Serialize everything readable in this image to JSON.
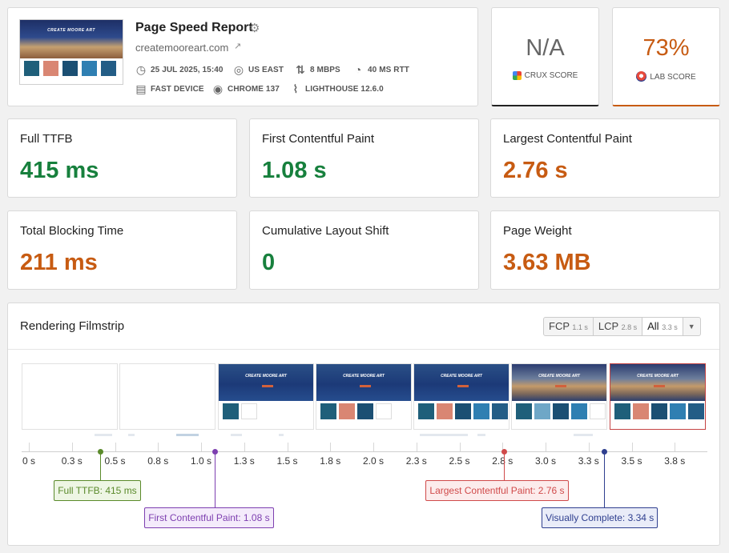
{
  "header": {
    "title": "Page Speed Report",
    "url": "createmooreart.com",
    "thumb_title": "CREATE MOORE ART",
    "meta": [
      {
        "icon": "clock-icon",
        "label": "25 JUL 2025, 15:40"
      },
      {
        "icon": "globe-icon",
        "label": "US EAST"
      },
      {
        "icon": "bandwidth-icon",
        "label": "8 MBPS"
      },
      {
        "icon": "gauge-icon",
        "label": "40 MS RTT"
      },
      {
        "icon": "device-icon",
        "label": "FAST DEVICE"
      },
      {
        "icon": "chrome-icon",
        "label": "CHROME 137"
      },
      {
        "icon": "lighthouse-icon",
        "label": "LIGHTHOUSE 12.6.0"
      }
    ]
  },
  "scores": {
    "crux": {
      "value": "N/A",
      "label": "CRUX SCORE"
    },
    "lab": {
      "value": "73%",
      "label": "LAB SCORE"
    }
  },
  "metrics": [
    {
      "label": "Full TTFB",
      "value": "415 ms",
      "status": "good"
    },
    {
      "label": "First Contentful Paint",
      "value": "1.08 s",
      "status": "good"
    },
    {
      "label": "Largest Contentful Paint",
      "value": "2.76 s",
      "status": "warn"
    },
    {
      "label": "Total Blocking Time",
      "value": "211 ms",
      "status": "warn"
    },
    {
      "label": "Cumulative Layout Shift",
      "value": "0",
      "status": "good"
    },
    {
      "label": "Page Weight",
      "value": "3.63 MB",
      "status": "warn"
    }
  ],
  "filmstrip": {
    "title": "Rendering Filmstrip",
    "filters": [
      {
        "label": "FCP",
        "sub": "1.1 s"
      },
      {
        "label": "LCP",
        "sub": "2.8 s"
      },
      {
        "label": "All",
        "sub": "3.3 s"
      }
    ],
    "frame_title": "CREATE MOORE ART",
    "ticks": [
      "0 s",
      "0.3 s",
      "0.5 s",
      "0.8 s",
      "1.0 s",
      "1.3 s",
      "1.5 s",
      "1.8 s",
      "2.0 s",
      "2.3 s",
      "2.5 s",
      "2.8 s",
      "3.0 s",
      "3.3 s",
      "3.5 s",
      "3.8 s"
    ],
    "markers": [
      {
        "label": "Full TTFB: 415 ms",
        "time": 0.415,
        "color": "#5a8a2a",
        "bg": "#eef6e4"
      },
      {
        "label": "First Contentful Paint: 1.08 s",
        "time": 1.08,
        "color": "#7d3fb0",
        "bg": "#f4ebfb"
      },
      {
        "label": "Largest Contentful Paint: 2.76 s",
        "time": 2.76,
        "color": "#d04a4a",
        "bg": "#fcecec"
      },
      {
        "label": "Visually Complete: 3.34 s",
        "time": 3.34,
        "color": "#2f3f8f",
        "bg": "#e9ecf8"
      }
    ]
  },
  "colors": {
    "good": "#17803d",
    "warn": "#c75b12"
  }
}
